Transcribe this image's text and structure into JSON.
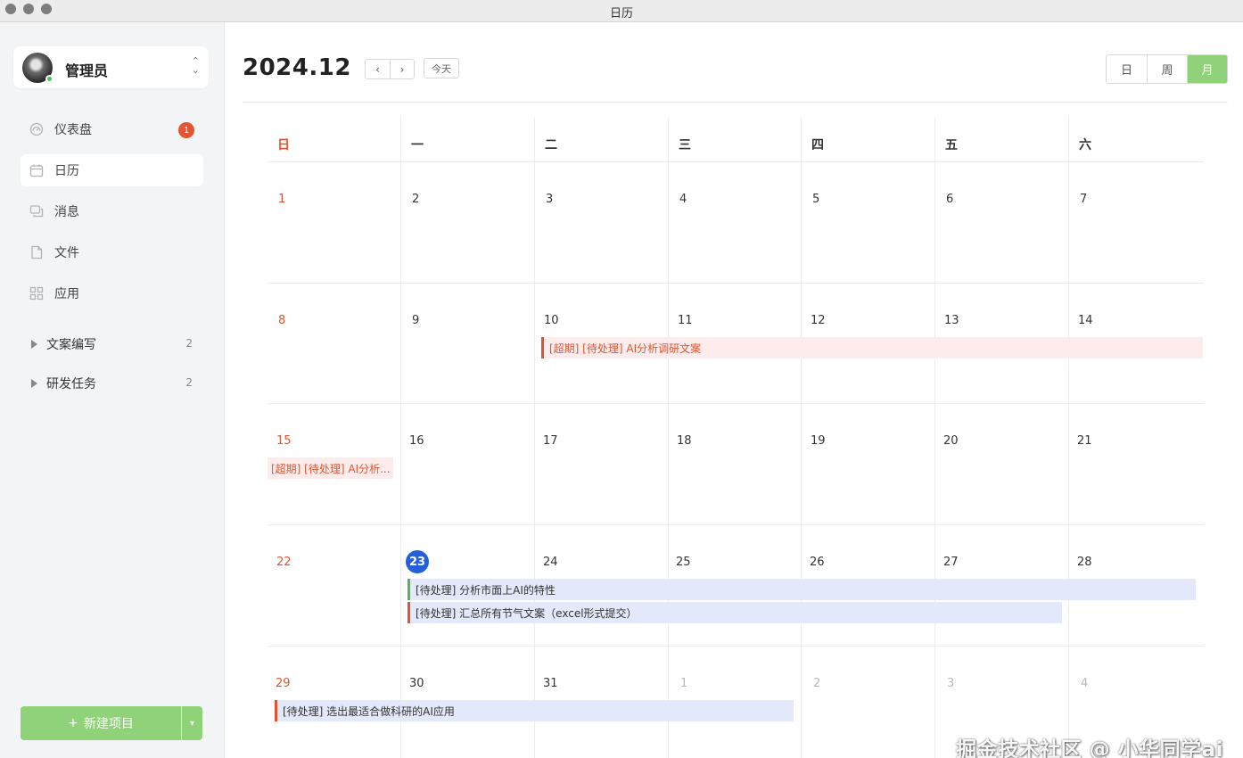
{
  "window": {
    "title": "日历"
  },
  "sidebar": {
    "user": {
      "name": "管理员"
    },
    "nav": [
      {
        "key": "dashboard",
        "label": "仪表盘",
        "icon": "dashboard-icon",
        "badge": "1"
      },
      {
        "key": "calendar",
        "label": "日历",
        "icon": "calendar-icon",
        "active": true
      },
      {
        "key": "messages",
        "label": "消息",
        "icon": "message-icon"
      },
      {
        "key": "files",
        "label": "文件",
        "icon": "file-icon"
      },
      {
        "key": "apps",
        "label": "应用",
        "icon": "apps-icon"
      }
    ],
    "groups": [
      {
        "label": "文案编写",
        "count": "2"
      },
      {
        "label": "研发任务",
        "count": "2"
      }
    ],
    "new_button": {
      "label": "新建项目",
      "plus": "+"
    }
  },
  "header": {
    "month": "2024.12",
    "prev": "‹",
    "next": "›",
    "today": "今天",
    "views": [
      "日",
      "周",
      "月"
    ],
    "active_view": "月"
  },
  "calendar": {
    "weekdays": [
      "日",
      "一",
      "二",
      "三",
      "四",
      "五",
      "六"
    ],
    "weeks": [
      [
        "1",
        "2",
        "3",
        "4",
        "5",
        "6",
        "7"
      ],
      [
        "8",
        "9",
        "10",
        "11",
        "12",
        "13",
        "14"
      ],
      [
        "15",
        "16",
        "17",
        "18",
        "19",
        "20",
        "21"
      ],
      [
        "22",
        "23",
        "24",
        "25",
        "26",
        "27",
        "28"
      ],
      [
        "29",
        "30",
        "31",
        "1",
        "2",
        "3",
        "4"
      ]
    ],
    "today": "23",
    "events": [
      {
        "text": "[超期] [待处理] AI分析调研文案"
      },
      {
        "text": "[超期] [待处理] AI分析..."
      },
      {
        "text": "[待处理] 分析市面上AI的特性"
      },
      {
        "text": "[待处理] 汇总所有节气文案（excel形式提交）"
      },
      {
        "text": "[待处理] 选出最适合做科研的AI应用"
      }
    ]
  },
  "watermark": "掘金技术社区 @ 小华同学ai"
}
